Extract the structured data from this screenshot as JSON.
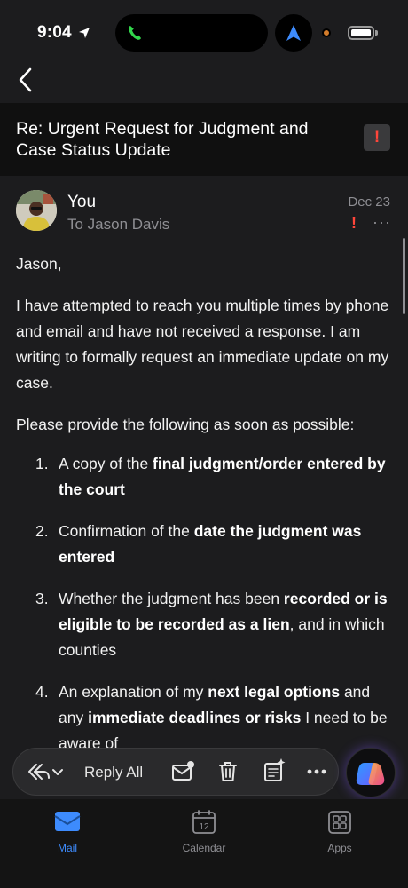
{
  "status_bar": {
    "time": "9:04"
  },
  "header": {
    "subject": "Re: Urgent Request for Judgment and Case Status Update",
    "important_mark": "!"
  },
  "message": {
    "sender": "You",
    "recipient": "To Jason Davis",
    "date": "Dec 23",
    "flag_mark": "!",
    "more": "···"
  },
  "body": {
    "greeting": "Jason,",
    "paragraph1": "I have attempted to reach you multiple times by phone and email and have not received a response. I am writing to formally request an immediate update on my case.",
    "paragraph2": "Please provide the following as soon as possible:",
    "items": [
      {
        "num": "1.",
        "pre": "A copy of the ",
        "bold": "final judgment/order entered by the court",
        "post": "",
        "bold2": "",
        "post2": ""
      },
      {
        "num": "2.",
        "pre": "Confirmation of the ",
        "bold": "date the judgment was entered",
        "post": "",
        "bold2": "",
        "post2": ""
      },
      {
        "num": "3.",
        "pre": "Whether the judgment has been ",
        "bold": "recorded or is eligible to be recorded as a lien",
        "post": ", and in which counties",
        "bold2": "",
        "post2": ""
      },
      {
        "num": "4.",
        "pre": "An explanation of my ",
        "bold": "next legal options",
        "post": " and any ",
        "bold2": "immediate deadlines or risks",
        "post2": " I need to be aware of"
      }
    ]
  },
  "reply_bar": {
    "reply_all_label": "Reply All"
  },
  "tabs": [
    {
      "label": "Mail",
      "active": true
    },
    {
      "label": "Calendar",
      "active": false,
      "badge": "12"
    },
    {
      "label": "Apps",
      "active": false
    }
  ],
  "colors": {
    "accent": "#3d8bfd",
    "flag_red": "#ff453a",
    "background": "#1c1c1e"
  }
}
